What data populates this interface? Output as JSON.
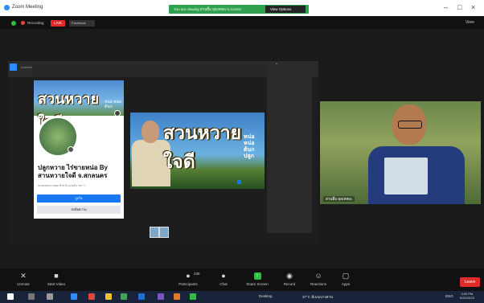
{
  "window": {
    "title": "Zoom Meeting",
    "banner": "You are viewing ส่วนฮิ้ม ยุลเหทยะ's screen",
    "view_options": "View Options"
  },
  "meeting_bar": {
    "recording_label": "Recording",
    "live_label": "LIVE",
    "facebook_label": "Facebook",
    "view_label": "View"
  },
  "shared_screen": {
    "window_name": "Livestream",
    "page_name": "ปลูกหวาย ไร่ขายหน่อ By สานหวายใจดี จ.สกลนคร",
    "page_sub": "ขายหน่อหวายสด ทำหวัง แกงส้ม ฯลฯ ฯ",
    "like_button": "ถูกใจ",
    "message_button": "ส่งข้อความ",
    "cover_text": "สวนหวายใจดี",
    "cover_side_text": "หน่อ หน่อ ต้นก",
    "banner_title": "สวนหวายใจดี",
    "banner_side_text": "หน่อ หน่อ ต้นก ปลูก"
  },
  "speaker": {
    "name": "ส่วนฮิ้ม ยุลเหทยะ"
  },
  "toolbar": {
    "unmute": "Unmute",
    "start_video": "Start Video",
    "participants": "Participants",
    "participants_count": "235",
    "chat": "Chat",
    "share_screen": "Share Screen",
    "record": "Record",
    "reactions": "Reactions",
    "apps": "Apps",
    "leave": "Leave"
  },
  "taskbar": {
    "desktop": "Desktop",
    "weather": "37°C มีเมฆบางส่วน",
    "lang": "ENG",
    "time": "3:00 PM",
    "date": "5/20/2023"
  },
  "colors": {
    "zoom_blue": "#2d8cff",
    "share_green": "#2fbe41",
    "leave_red": "#e02b2b",
    "live_red": "#e02b2b"
  }
}
